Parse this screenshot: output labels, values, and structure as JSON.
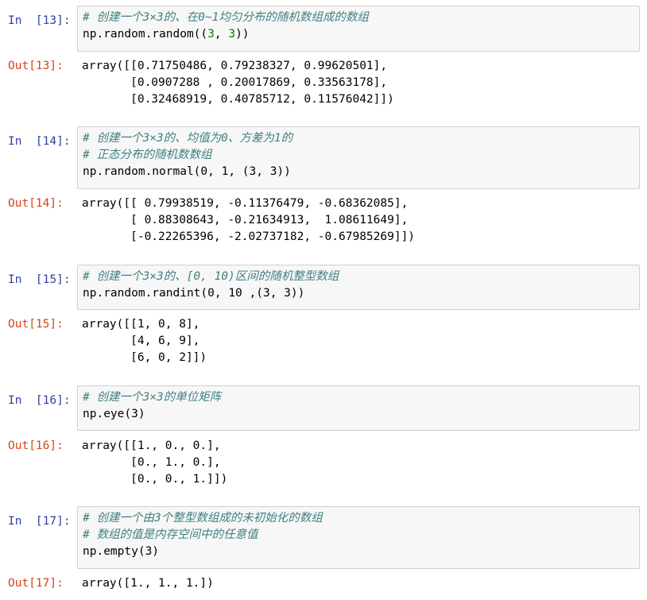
{
  "cells": [
    {
      "in_prompt": "In  [13]:",
      "out_prompt": "Out[13]:",
      "comments": [
        "# 创建一个3×3的、在0~1均匀分布的随机数组成的数组"
      ],
      "code": {
        "pre": "np.random.random((",
        "n1": "3",
        "mid": ", ",
        "n2": "3",
        "post": "))"
      },
      "output": [
        "array([[0.71750486, 0.79238327, 0.99620501],",
        "       [0.0907288 , 0.20017869, 0.33563178],",
        "       [0.32468919, 0.40785712, 0.11576042]])"
      ]
    },
    {
      "in_prompt": "In  [14]:",
      "out_prompt": "Out[14]:",
      "comments": [
        "# 创建一个3×3的、均值为0、方差为1的",
        "# 正态分布的随机数数组"
      ],
      "code": {
        "pre": "np.random.normal(0, 1, (3, 3))"
      },
      "output": [
        "array([[ 0.79938519, -0.11376479, -0.68362085],",
        "       [ 0.88308643, -0.21634913,  1.08611649],",
        "       [-0.22265396, -2.02737182, -0.67985269]])"
      ]
    },
    {
      "in_prompt": "In  [15]:",
      "out_prompt": "Out[15]:",
      "comments": [
        "# 创建一个3×3的、[0, 10)区间的随机整型数组"
      ],
      "code": {
        "pre": "np.random.randint(0, 10 ,(3, 3))"
      },
      "output": [
        "array([[1, 0, 8],",
        "       [4, 6, 9],",
        "       [6, 0, 2]])"
      ]
    },
    {
      "in_prompt": "In  [16]:",
      "out_prompt": "Out[16]:",
      "comments": [
        "# 创建一个3×3的单位矩阵"
      ],
      "code": {
        "pre": "np.eye(3)"
      },
      "output": [
        "array([[1., 0., 0.],",
        "       [0., 1., 0.],",
        "       [0., 0., 1.]])"
      ]
    },
    {
      "in_prompt": "In  [17]:",
      "out_prompt": "Out[17]:",
      "comments": [
        "# 创建一个由3个整型数组成的未初始化的数组",
        "# 数组的值是内存空间中的任意值"
      ],
      "code": {
        "pre": "np.empty(3)"
      },
      "output": [
        "array([1., 1., 1.])"
      ]
    }
  ]
}
